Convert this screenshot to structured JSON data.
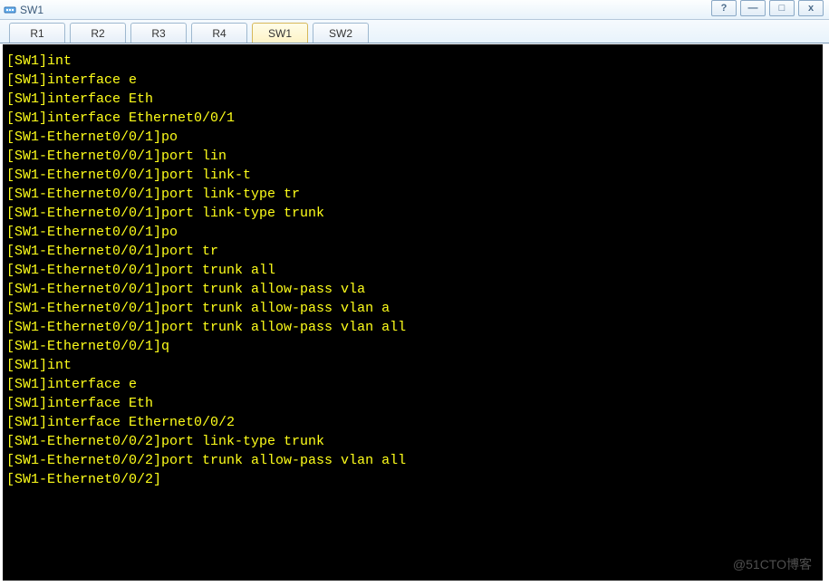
{
  "window": {
    "title": "SW1",
    "controls": {
      "help": "?",
      "min": "—",
      "max": "□",
      "close": "x"
    }
  },
  "tabs": [
    {
      "label": "R1",
      "active": false
    },
    {
      "label": "R2",
      "active": false
    },
    {
      "label": "R3",
      "active": false
    },
    {
      "label": "R4",
      "active": false
    },
    {
      "label": "SW1",
      "active": true
    },
    {
      "label": "SW2",
      "active": false
    }
  ],
  "terminal_lines": [
    "[SW1]int",
    "[SW1]interface e",
    "[SW1]interface Eth",
    "[SW1]interface Ethernet0/0/1",
    "[SW1-Ethernet0/0/1]po",
    "[SW1-Ethernet0/0/1]port lin",
    "[SW1-Ethernet0/0/1]port link-t",
    "[SW1-Ethernet0/0/1]port link-type tr",
    "[SW1-Ethernet0/0/1]port link-type trunk",
    "[SW1-Ethernet0/0/1]po",
    "[SW1-Ethernet0/0/1]port tr",
    "[SW1-Ethernet0/0/1]port trunk all",
    "[SW1-Ethernet0/0/1]port trunk allow-pass vla",
    "[SW1-Ethernet0/0/1]port trunk allow-pass vlan a",
    "[SW1-Ethernet0/0/1]port trunk allow-pass vlan all",
    "[SW1-Ethernet0/0/1]q",
    "[SW1]int",
    "[SW1]interface e",
    "[SW1]interface Eth",
    "[SW1]interface Ethernet0/0/2",
    "[SW1-Ethernet0/0/2]port link-type trunk",
    "[SW1-Ethernet0/0/2]port trunk allow-pass vlan all",
    "[SW1-Ethernet0/0/2]"
  ],
  "watermark": "@51CTO博客"
}
